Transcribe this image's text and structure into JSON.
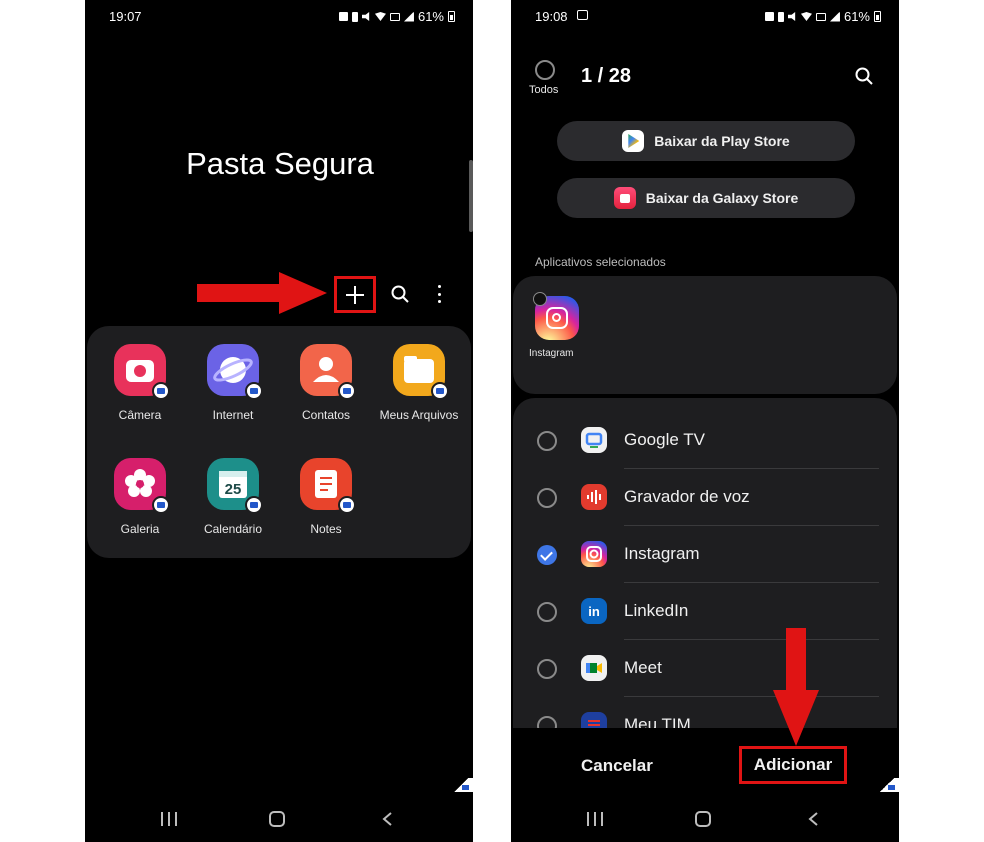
{
  "left_screen": {
    "status": {
      "time": "19:07",
      "battery": "61%"
    },
    "title": "Pasta Segura",
    "toolbar": {
      "add_icon": "plus-icon",
      "search_icon": "search-icon",
      "more_icon": "more-vertical-icon"
    },
    "apps": [
      {
        "label": "Câmera",
        "icon": "camera-icon",
        "color": "#e8325b"
      },
      {
        "label": "Internet",
        "icon": "internet-icon",
        "color": "#6b63e6"
      },
      {
        "label": "Contatos",
        "icon": "contacts-icon",
        "color": "#f2654a"
      },
      {
        "label": "Meus Arquivos",
        "icon": "folder-icon",
        "color": "#f2a81c"
      },
      {
        "label": "Galeria",
        "icon": "gallery-icon",
        "color": "#d61f6b"
      },
      {
        "label": "Calendário",
        "icon": "calendar-icon",
        "color": "#1d8f8a",
        "day": "25"
      },
      {
        "label": "Notes",
        "icon": "notes-icon",
        "color": "#e8442c"
      }
    ]
  },
  "right_screen": {
    "status": {
      "time": "19:08",
      "battery": "61%"
    },
    "select_all_label": "Todos",
    "count": "1 / 28",
    "store_buttons": {
      "play": "Baixar da Play Store",
      "galaxy": "Baixar da Galaxy Store"
    },
    "selected_heading": "Aplicativos selecionados",
    "selected_apps": [
      {
        "label": "Instagram",
        "icon": "instagram-icon"
      }
    ],
    "list": [
      {
        "label": "Google TV",
        "icon": "google-tv-icon",
        "checked": false
      },
      {
        "label": "Gravador de voz",
        "icon": "voice-recorder-icon",
        "checked": false
      },
      {
        "label": "Instagram",
        "icon": "instagram-icon",
        "checked": true
      },
      {
        "label": "LinkedIn",
        "icon": "linkedin-icon",
        "checked": false
      },
      {
        "label": "Meet",
        "icon": "meet-icon",
        "checked": false
      },
      {
        "label": "Meu TIM",
        "icon": "meu-tim-icon",
        "checked": false
      }
    ],
    "cancel_label": "Cancelar",
    "add_label": "Adicionar"
  },
  "annotation_color": "#e01414",
  "accent_color": "#3e76e6"
}
